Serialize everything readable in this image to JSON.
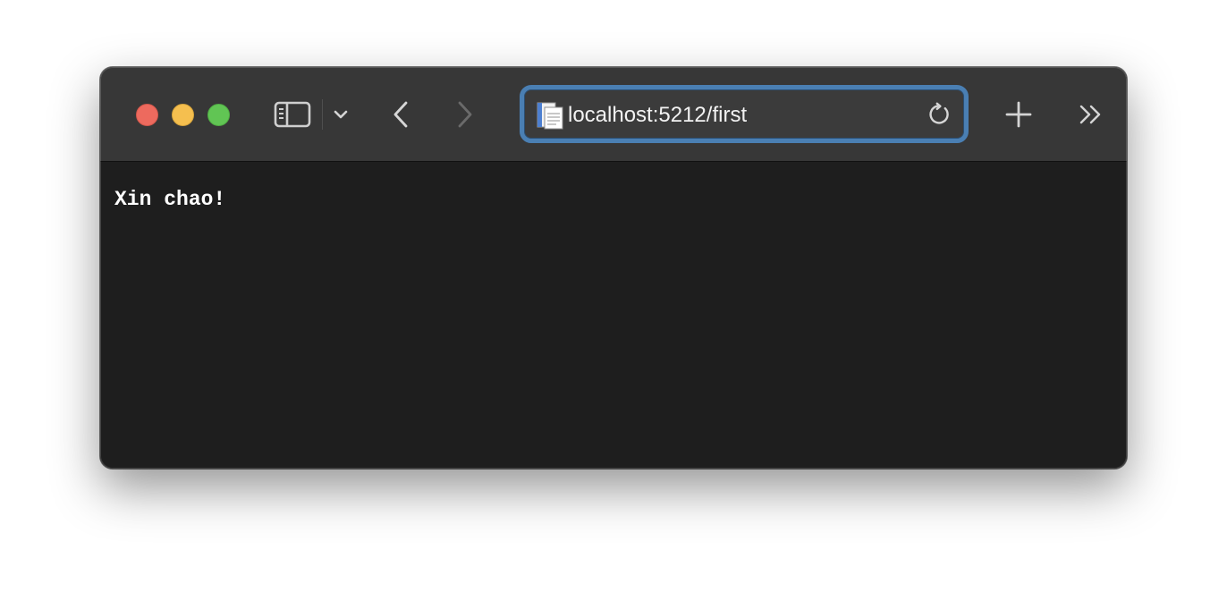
{
  "browser": {
    "window_controls": {
      "close_color": "#ed6a5e",
      "minimize_color": "#f5bf4f",
      "zoom_color": "#61c554"
    },
    "toolbar": {
      "sidebar_icon": "sidebar-icon",
      "tab_overview_icon": "chevron-down-icon",
      "back_icon": "chevron-left-icon",
      "forward_icon": "chevron-right-icon",
      "new_tab_icon": "plus-icon",
      "more_icon": "double-chevron-right-icon"
    },
    "address_bar": {
      "url": "localhost:5212/first",
      "page_icon": "document-icon",
      "reload_icon": "reload-icon",
      "focus_ring_color": "#4a7fb3"
    }
  },
  "page": {
    "body_text": "Xin chao!"
  }
}
